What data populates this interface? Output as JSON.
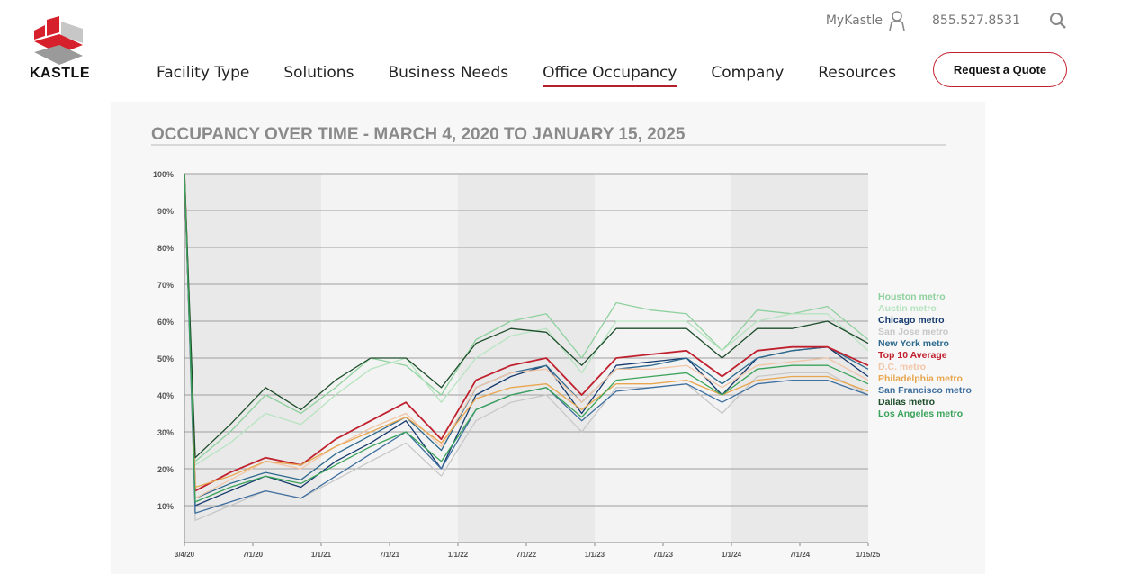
{
  "brand": {
    "name": "KASTLE",
    "colors": {
      "red": "#d6202b",
      "gray": "#9a9a9a",
      "dark": "#222222"
    }
  },
  "utility": {
    "mykastle": "MyKastle",
    "phone": "855.527.8531",
    "icons": [
      "user-icon",
      "search-icon"
    ]
  },
  "nav": {
    "items": [
      "Facility Type",
      "Solutions",
      "Business Needs",
      "Office Occupancy",
      "Company",
      "Resources"
    ],
    "active": "Office Occupancy"
  },
  "cta": {
    "label": "Request a Quote"
  },
  "chart_data": {
    "type": "line",
    "title": "OCCUPANCY OVER TIME - MARCH 4, 2020 TO JANUARY 15, 2025",
    "x_ticks": [
      "3/4/20",
      "7/1/20",
      "1/1/21",
      "7/1/21",
      "1/1/22",
      "7/1/22",
      "1/1/23",
      "7/1/23",
      "1/1/24",
      "7/1/24",
      "1/15/25"
    ],
    "y_ticks": [
      "100%",
      "90%",
      "80%",
      "70%",
      "60%",
      "50%",
      "40%",
      "30%",
      "20%",
      "10%"
    ],
    "ylim": [
      0,
      100
    ],
    "grid": true,
    "legend_position": "right",
    "x": [
      "3/4/20",
      "4/1/20",
      "7/1/20",
      "10/1/20",
      "1/1/21",
      "4/1/21",
      "7/1/21",
      "10/1/21",
      "1/1/22",
      "4/1/22",
      "7/1/22",
      "10/1/22",
      "1/1/23",
      "4/1/23",
      "7/1/23",
      "10/1/23",
      "1/1/24",
      "4/1/24",
      "7/1/24",
      "10/1/24",
      "1/15/25"
    ],
    "series": [
      {
        "name": "Houston metro",
        "color": "#8fd19e",
        "values": [
          100,
          22,
          30,
          40,
          35,
          42,
          50,
          48,
          40,
          55,
          60,
          62,
          50,
          65,
          63,
          62,
          52,
          63,
          62,
          64,
          55
        ]
      },
      {
        "name": "Austin metro",
        "color": "#b7e4c0",
        "values": [
          100,
          21,
          27,
          35,
          32,
          40,
          47,
          50,
          38,
          50,
          56,
          58,
          46,
          60,
          60,
          60,
          52,
          60,
          62,
          62,
          52
        ]
      },
      {
        "name": "Chicago metro",
        "color": "#153a6e",
        "values": [
          100,
          10,
          14,
          18,
          15,
          22,
          27,
          33,
          20,
          40,
          45,
          48,
          35,
          48,
          49,
          50,
          40,
          50,
          52,
          53,
          45
        ]
      },
      {
        "name": "San Jose metro",
        "color": "#c8c8c8",
        "values": [
          100,
          6,
          10,
          14,
          12,
          17,
          22,
          27,
          18,
          33,
          38,
          40,
          30,
          42,
          42,
          43,
          35,
          45,
          46,
          46,
          40
        ]
      },
      {
        "name": "New York metro",
        "color": "#2e6a8f",
        "values": [
          100,
          12,
          16,
          19,
          17,
          24,
          29,
          34,
          25,
          42,
          46,
          48,
          38,
          47,
          48,
          50,
          43,
          50,
          52,
          53,
          47
        ]
      },
      {
        "name": "Top 10 Average",
        "color": "#c0212e",
        "values": [
          100,
          14,
          19,
          23,
          21,
          28,
          33,
          38,
          28,
          44,
          48,
          50,
          40,
          50,
          51,
          52,
          45,
          52,
          53,
          53,
          48
        ]
      },
      {
        "name": "D.C. metro",
        "color": "#f2c6a8",
        "values": [
          100,
          12,
          17,
          22,
          20,
          26,
          31,
          35,
          26,
          42,
          46,
          47,
          38,
          47,
          47,
          48,
          42,
          48,
          49,
          50,
          44
        ]
      },
      {
        "name": "Philadelphia metro",
        "color": "#e8a64f",
        "values": [
          100,
          15,
          18,
          22,
          21,
          26,
          30,
          34,
          27,
          39,
          42,
          43,
          36,
          43,
          43,
          44,
          40,
          44,
          45,
          45,
          41
        ]
      },
      {
        "name": "San Francisco metro",
        "color": "#3f6f9f",
        "values": [
          100,
          8,
          11,
          14,
          12,
          18,
          24,
          30,
          20,
          36,
          40,
          42,
          33,
          41,
          42,
          43,
          38,
          43,
          44,
          44,
          40
        ]
      },
      {
        "name": "Dallas metro",
        "color": "#1d4d2b",
        "values": [
          100,
          23,
          32,
          42,
          36,
          44,
          50,
          50,
          42,
          54,
          58,
          57,
          48,
          58,
          58,
          58,
          50,
          58,
          58,
          60,
          54
        ]
      },
      {
        "name": "Los Angeles metro",
        "color": "#3aa35b",
        "values": [
          100,
          11,
          15,
          18,
          16,
          21,
          26,
          30,
          22,
          36,
          40,
          42,
          34,
          44,
          45,
          46,
          40,
          47,
          48,
          48,
          43
        ]
      }
    ]
  }
}
